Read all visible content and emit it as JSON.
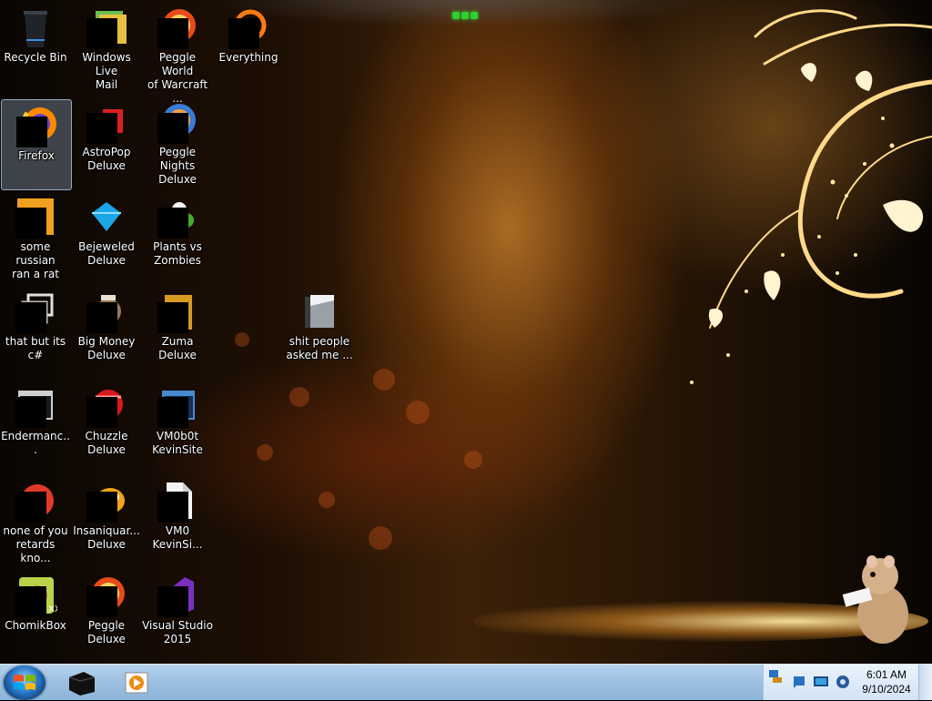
{
  "desktop": {
    "icons": [
      {
        "label": "Recycle Bin",
        "icon": "recycle-bin-icon"
      },
      {
        "label": "Windows Live\nMail",
        "icon": "windows-live-mail-icon"
      },
      {
        "label": "Peggle World\nof Warcraft ...",
        "icon": "peggle-wow-icon"
      },
      {
        "label": "Everything",
        "icon": "everything-search-icon"
      },
      {
        "label": "Firefox",
        "icon": "firefox-icon"
      },
      {
        "label": "AstroPop\nDeluxe",
        "icon": "astropop-icon"
      },
      {
        "label": "Peggle Nights\nDeluxe",
        "icon": "peggle-nights-icon"
      },
      {
        "label": "some russian\nran a rat",
        "icon": "shortcut-icon"
      },
      {
        "label": "Bejeweled\nDeluxe",
        "icon": "bejeweled-icon"
      },
      {
        "label": "Plants vs\nZombies",
        "icon": "plants-vs-zombies-icon"
      },
      {
        "label": "that but its c#",
        "icon": "shortcut-icon"
      },
      {
        "label": "Big Money\nDeluxe",
        "icon": "big-money-icon"
      },
      {
        "label": "Zuma Deluxe",
        "icon": "zuma-icon"
      },
      {
        "label": "shit people\nasked me ...",
        "icon": "folder-icon"
      },
      {
        "label": "Endermanc...",
        "icon": "app-window-icon"
      },
      {
        "label": "Chuzzle\nDeluxe",
        "icon": "chuzzle-icon"
      },
      {
        "label": "VM0b0t\nKevinSite",
        "icon": "vm-window-icon"
      },
      {
        "label": "none of you\nretards kno...",
        "icon": "shortcut-icon"
      },
      {
        "label": "Insaniquar...\nDeluxe",
        "icon": "insaniquarium-icon"
      },
      {
        "label": "VM0\nKevinSi...",
        "icon": "document-icon"
      },
      {
        "label": "ChomikBox",
        "icon": "chomikbox-icon"
      },
      {
        "label": "Peggle Deluxe",
        "icon": "peggle-icon"
      },
      {
        "label": "Visual Studio\n2015",
        "icon": "visual-studio-icon"
      }
    ],
    "selected_icon": "Firefox"
  },
  "taskbar": {
    "start_button": "windows-orb-icon",
    "pinned": [
      "command-prompt-icon",
      "media-player-icon"
    ],
    "tray_icons": [
      "network-icon",
      "action-center-icon",
      "display-icon",
      "volume-icon"
    ],
    "clock": {
      "time": "6:01 AM",
      "date": "9/10/2024"
    }
  },
  "colors": {
    "taskbar": "#9ec1e2",
    "selection": "#b4d2f0",
    "accent_green": "#2fd02f"
  }
}
